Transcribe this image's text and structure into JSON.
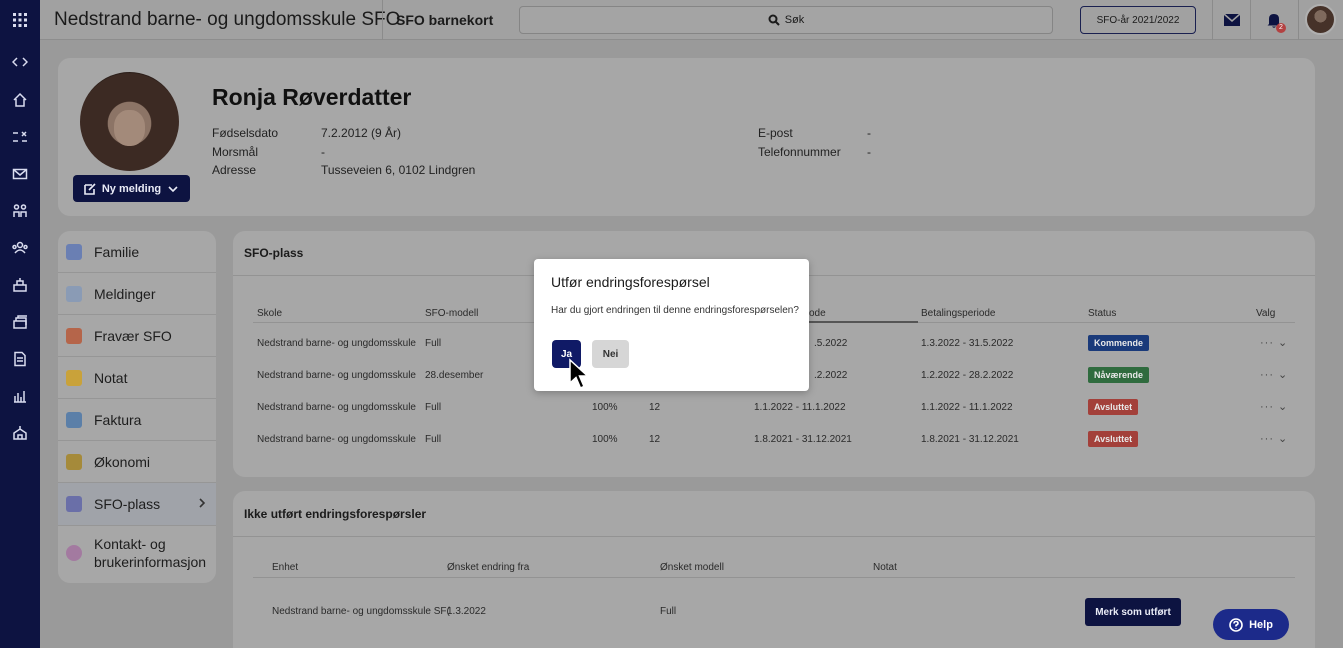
{
  "topbar": {
    "school_title": "Nedstrand barne- og ungdomsskule SFO",
    "card_title": "SFO barnekort",
    "search_label": "Søk",
    "year_button": "SFO-år 2021/2022",
    "notification_count": "2"
  },
  "rail": {
    "icons": [
      "apps-icon",
      "code-icon",
      "home-icon",
      "compare-icon",
      "mail-icon",
      "groups-icon",
      "people-icon",
      "building-icon",
      "stack-icon",
      "document-icon",
      "chart-icon",
      "school-icon"
    ]
  },
  "profile": {
    "name": "Ronja Røverdatter",
    "new_message_label": "Ny melding",
    "fields": {
      "birth_label": "Fødselsdato",
      "birth_value": "7.2.2012 (9 År)",
      "language_label": "Morsmål",
      "language_value": "-",
      "address_label": "Adresse",
      "address_value": "Tusseveien 6, 0102 Lindgren",
      "email_label": "E-post",
      "email_value": "-",
      "phone_label": "Telefonnummer",
      "phone_value": "-"
    }
  },
  "sidenav": {
    "items": [
      {
        "label": "Familie",
        "color": "#6a7fb3"
      },
      {
        "label": "Meldinger",
        "color": "#8a9bb5"
      },
      {
        "label": "Fravær SFO",
        "color": "#b5654a"
      },
      {
        "label": "Notat",
        "color": "#c9a23a"
      },
      {
        "label": "Faktura",
        "color": "#5b7fa8"
      },
      {
        "label": "Økonomi",
        "color": "#a58a3a"
      },
      {
        "label": "SFO-plass",
        "color": "#6a6fa8"
      },
      {
        "label": "Kontakt- og brukerinformasjon",
        "color": "#a37aa0"
      }
    ]
  },
  "sfo": {
    "title": "SFO-plass",
    "headers": [
      "Skole",
      "SFO-modell",
      "ode",
      "Betalingsperiode",
      "Status",
      "Valg"
    ],
    "rows": [
      {
        "school": "Nedstrand barne- og ungdomsskule",
        "model": "Full",
        "pct": "",
        "num": "",
        "period": ".5.2022",
        "payment": "1.3.2022 - 31.5.2022",
        "status": "Kommende",
        "status_color": "#1a3a7a"
      },
      {
        "school": "Nedstrand barne- og ungdomsskule",
        "model": "28.desember",
        "pct": "",
        "num": "",
        "period": ".2.2022",
        "payment": "1.2.2022 - 28.2.2022",
        "status": "Nåværende",
        "status_color": "#2f6b3e"
      },
      {
        "school": "Nedstrand barne- og ungdomsskule",
        "model": "Full",
        "pct": "100%",
        "num": "12",
        "period": "1.1.2022 - 11.1.2022",
        "payment": "1.1.2022 - 11.1.2022",
        "status": "Avsluttet",
        "status_color": "#a3403a"
      },
      {
        "school": "Nedstrand barne- og ungdomsskule",
        "model": "Full",
        "pct": "100%",
        "num": "12",
        "period": "1.8.2021 - 31.12.2021",
        "payment": "1.8.2021 - 31.12.2021",
        "status": "Avsluttet",
        "status_color": "#a3403a"
      }
    ]
  },
  "requests": {
    "title": "Ikke utført endringsforespørsler",
    "headers": [
      "Enhet",
      "Ønsket endring fra",
      "Ønsket modell",
      "Notat"
    ],
    "row": {
      "unit": "Nedstrand barne- og ungdomsskule SF(",
      "from": "1.3.2022",
      "model": "Full",
      "note": ""
    },
    "mark_done_label": "Merk som utført"
  },
  "dialog": {
    "title": "Utfør endringsforespørsel",
    "text": "Har du gjort endringen til denne endringsforespørselen?",
    "yes_label": "Ja",
    "no_label": "Nei"
  },
  "help_label": "Help"
}
